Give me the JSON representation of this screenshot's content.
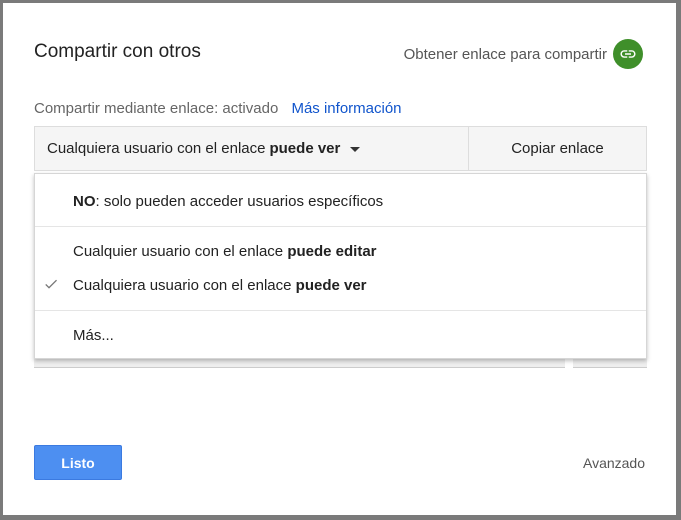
{
  "dialog": {
    "title": "Compartir con otros",
    "get_link_label": "Obtener enlace para compartir",
    "status_text": "Compartir mediante enlace: activado",
    "more_info_link": "Más información",
    "access_select": {
      "prefix": "Cualquiera usuario con el enlace",
      "bold": "puede ver"
    },
    "copy_button": "Copiar enlace",
    "menu": {
      "items": [
        {
          "bold": "NO",
          "text": ": solo pueden acceder usuarios específicos"
        },
        {
          "text": "Cualquier usuario con el enlace ",
          "bold": "puede editar"
        },
        {
          "text": "Cualquiera usuario con el enlace ",
          "bold": "puede ver",
          "checked": true
        },
        {
          "text": "Más..."
        }
      ]
    },
    "done_button": "Listo",
    "advanced_link": "Avanzado"
  },
  "colors": {
    "accent_blue": "#4d8ff1",
    "link_blue": "#1155cc",
    "link_icon_green": "#3f8f2a"
  },
  "icons": [
    "link-icon",
    "caret-down-icon",
    "checkmark-icon"
  ]
}
